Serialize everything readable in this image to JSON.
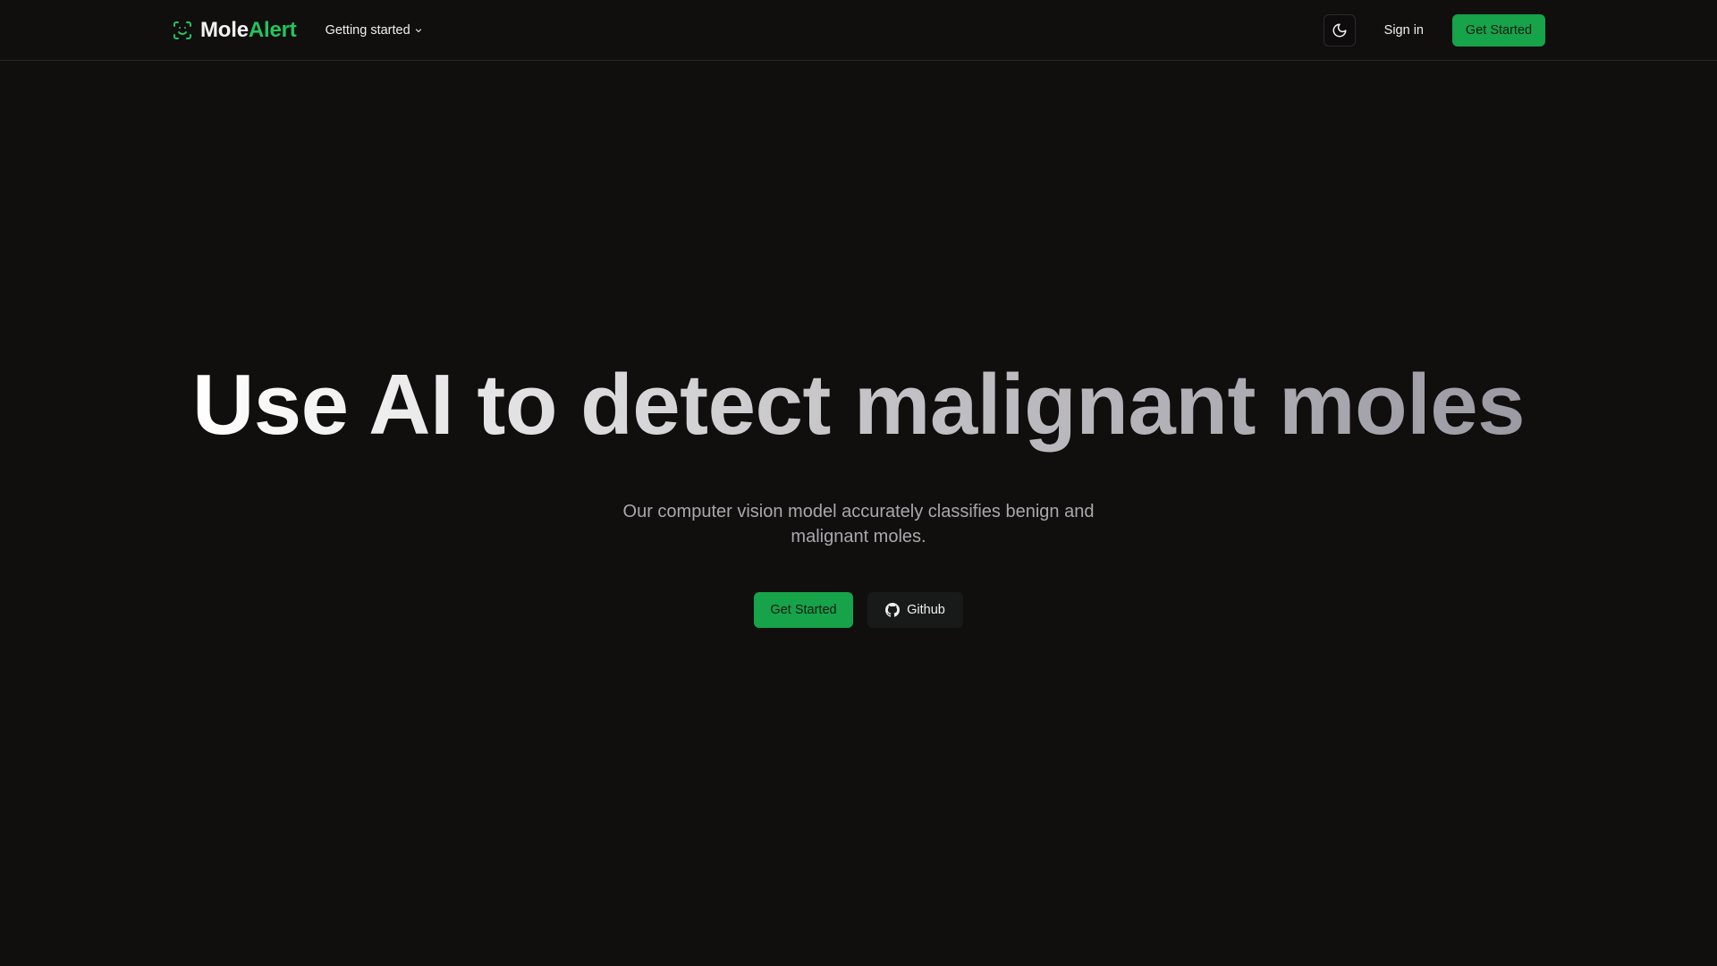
{
  "brand": {
    "name_part1": "Mole",
    "name_part2": "Alert"
  },
  "nav": {
    "menu_label": "Getting started",
    "sign_in_label": "Sign in",
    "cta_label": "Get Started"
  },
  "hero": {
    "title": "Use AI to detect malignant moles",
    "subtitle": "Our computer vision model accurately classifies benign and malignant moles.",
    "primary_label": "Get Started",
    "github_label": "Github"
  },
  "icons": {
    "logo": "scan-face-icon",
    "menu_chevron": "chevron-down-icon",
    "theme": "moon-icon",
    "github": "github-icon"
  },
  "colors": {
    "background": "#110e0e",
    "accent": "#16a34a",
    "brand_accent": "#22c55e"
  }
}
